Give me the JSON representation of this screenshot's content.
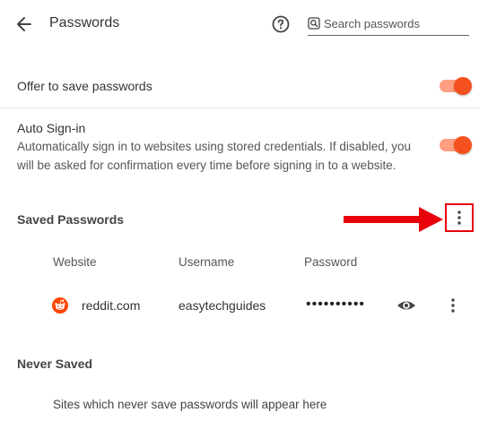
{
  "header": {
    "title": "Passwords",
    "back_icon": "arrow-left-icon",
    "help_icon": "help-circle-icon",
    "search_icon": "search-icon",
    "search_placeholder": "Search passwords",
    "search_value": ""
  },
  "settings": {
    "offer_to_save": {
      "label": "Offer to save passwords",
      "enabled": true
    },
    "auto_signin": {
      "title": "Auto Sign-in",
      "description": "Automatically sign in to websites using stored credentials. If disabled, you will be asked for confirmation every time before signing in to a website.",
      "enabled": true
    }
  },
  "saved_passwords": {
    "title": "Saved Passwords",
    "columns": {
      "website": "Website",
      "username": "Username",
      "password": "Password"
    },
    "rows": [
      {
        "website": "reddit.com",
        "favicon": "reddit-icon",
        "username": "easytechguides",
        "password_masked": "••••••••••"
      }
    ]
  },
  "never_saved": {
    "title": "Never Saved",
    "empty_message": "Sites which never save passwords will appear here"
  },
  "colors": {
    "accent": "#f4511e",
    "accent_track": "#ff9e80",
    "annotation_red": "#e8000b"
  }
}
